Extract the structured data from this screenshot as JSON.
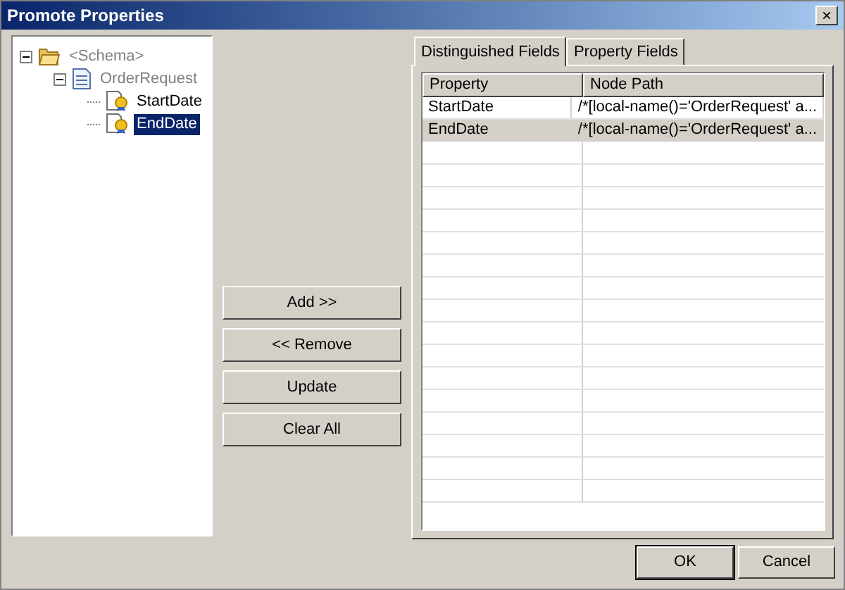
{
  "window": {
    "title": "Promote Properties",
    "close": "×"
  },
  "tree": [
    {
      "label": "<Schema>",
      "kind": "folder",
      "disabled": true,
      "selected": false,
      "expanded": true,
      "children": [
        {
          "label": "OrderRequest",
          "kind": "document",
          "disabled": true,
          "selected": false,
          "expanded": true,
          "children": [
            {
              "label": "StartDate",
              "kind": "property",
              "disabled": false,
              "selected": false
            },
            {
              "label": "EndDate",
              "kind": "property",
              "disabled": false,
              "selected": true
            }
          ]
        }
      ]
    }
  ],
  "buttons": [
    "Add >>",
    "<< Remove",
    "Update",
    "Clear All"
  ],
  "tabs": [
    {
      "label": "Distinguished Fields",
      "selected": true
    },
    {
      "label": "Property Fields",
      "selected": false
    }
  ],
  "table": {
    "columns": [
      "Property",
      "Node Path"
    ],
    "rows": [
      {
        "cells": [
          "StartDate",
          "/*[local-name()='OrderRequest' a..."
        ],
        "selected": false
      },
      {
        "cells": [
          "EndDate",
          "/*[local-name()='OrderRequest' a..."
        ],
        "selected": true
      }
    ]
  },
  "footer_buttons": [
    "OK",
    "Cancel"
  ]
}
